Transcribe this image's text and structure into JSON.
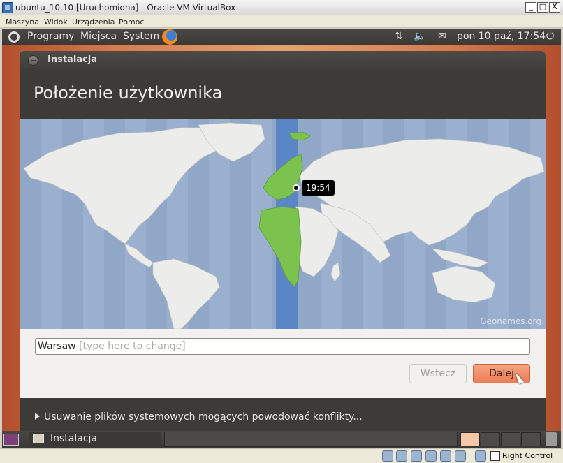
{
  "vbox": {
    "title": "ubuntu_10.10 [Uruchomiona] - Oracle VM VirtualBox",
    "menu": [
      "Maszyna",
      "Widok",
      "Urządzenia",
      "Pomoc"
    ],
    "window_buttons": {
      "minimize": "_",
      "maximize": "□",
      "close": "X"
    },
    "status_icons": [
      "hard-disk-icon",
      "cd-icon",
      "usb-icon",
      "network-icon",
      "shared-folders-icon",
      "display-icon",
      "mouse-integration-icon",
      "host-key-icon"
    ],
    "host_key": "Right Control"
  },
  "panel": {
    "menus": [
      "Programy",
      "Miejsca",
      "System"
    ],
    "clock": "pon 10 paź, 17:54"
  },
  "installer": {
    "window_title": "Instalacja",
    "heading": "Położenie użytkownika",
    "map": {
      "time": "19:54",
      "credit": "Geonames.org"
    },
    "location": {
      "value": "Warsaw",
      "hint": "[type here to change]"
    },
    "buttons": {
      "back": "Wstecz",
      "next": "Dalej"
    },
    "expander": "Usuwanie plików systemowych mogących powodować konflikty..."
  },
  "bottom_panel": {
    "task": "Instalacja"
  }
}
